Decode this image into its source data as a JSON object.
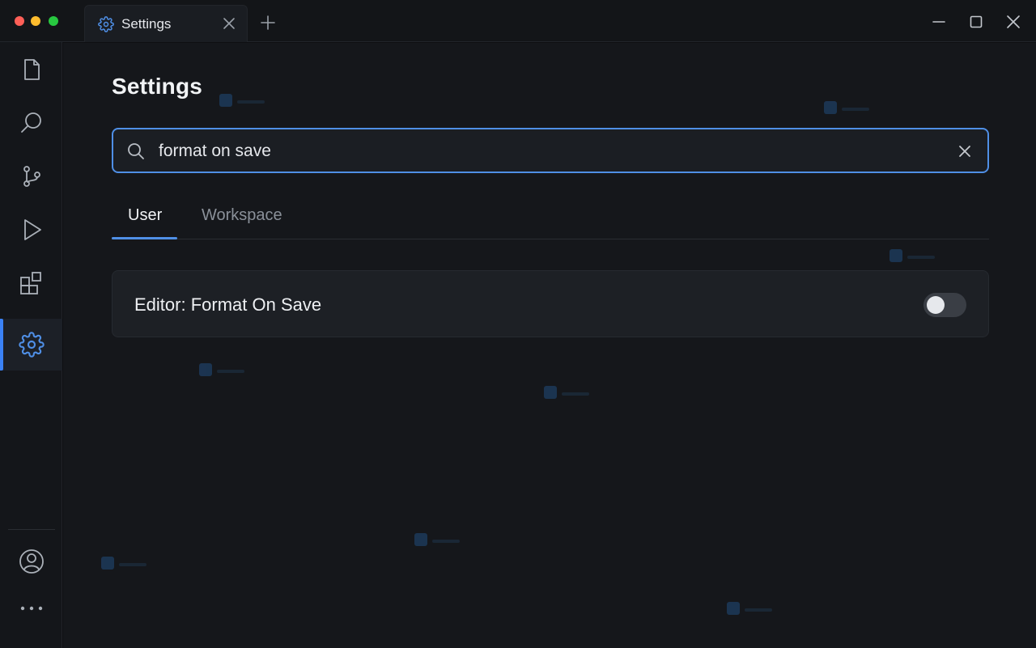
{
  "window": {
    "tab": {
      "label": "Settings",
      "icon": "gear-icon"
    }
  },
  "activity_bar": {
    "items": [
      {
        "name": "explorer",
        "icon": "file-icon"
      },
      {
        "name": "search",
        "icon": "search-icon"
      },
      {
        "name": "source-control",
        "icon": "source-control-icon"
      },
      {
        "name": "run",
        "icon": "play-icon"
      },
      {
        "name": "extensions",
        "icon": "extensions-icon"
      },
      {
        "name": "settings",
        "icon": "gear-icon",
        "active": true
      }
    ],
    "bottom": [
      {
        "name": "account",
        "icon": "account-icon"
      },
      {
        "name": "more",
        "icon": "more-icon"
      }
    ]
  },
  "settings": {
    "title": "Settings",
    "search": {
      "value": "format on save",
      "placeholder": ""
    },
    "tabs": [
      {
        "label": "User",
        "active": true
      },
      {
        "label": "Workspace",
        "active": false
      }
    ],
    "results": [
      {
        "label": "Editor: Format On Save",
        "enabled": false
      }
    ]
  },
  "colors": {
    "accent": "#4f8fe6",
    "background": "#15171b",
    "card": "#1d2025"
  }
}
